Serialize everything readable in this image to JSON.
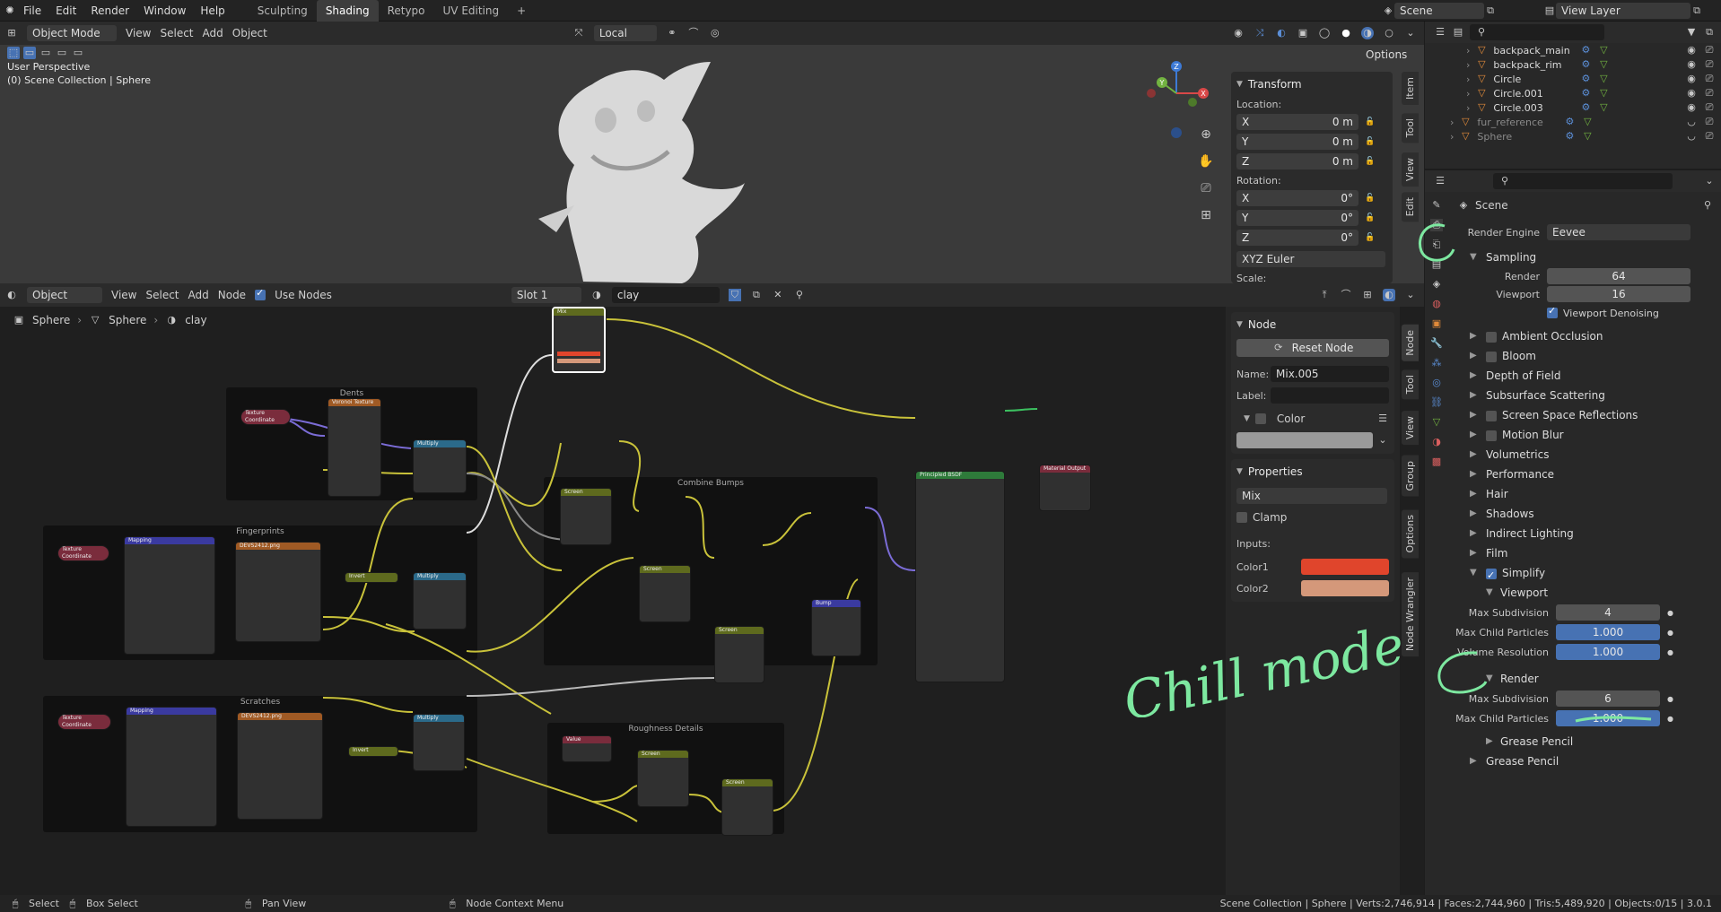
{
  "topbar": {
    "menus": [
      "File",
      "Edit",
      "Render",
      "Window",
      "Help"
    ],
    "workspaces": [
      "Sculpting",
      "Shading",
      "Retypo",
      "UV Editing"
    ],
    "active_workspace": "Shading",
    "add_tab": "+",
    "scene_name": "Scene",
    "view_layer": "View Layer"
  },
  "viewport": {
    "mode": "Object Mode",
    "menus": [
      "View",
      "Select",
      "Add",
      "Object"
    ],
    "orientation": "Local",
    "options": "Options",
    "overlay_title": "User Perspective",
    "overlay_sub": "(0) Scene Collection | Sphere",
    "gizmo": {
      "x": "X",
      "y": "Y",
      "z": "Z"
    },
    "tabs": [
      "Item",
      "Tool",
      "View",
      "Edit"
    ]
  },
  "transform": {
    "title": "Transform",
    "location_label": "Location:",
    "location": [
      {
        "axis": "X",
        "val": "0 m"
      },
      {
        "axis": "Y",
        "val": "0 m"
      },
      {
        "axis": "Z",
        "val": "0 m"
      }
    ],
    "rotation_label": "Rotation:",
    "rotation": [
      {
        "axis": "X",
        "val": "0°"
      },
      {
        "axis": "Y",
        "val": "0°"
      },
      {
        "axis": "Z",
        "val": "0°"
      }
    ],
    "euler": "XYZ Euler",
    "scale_label": "Scale:"
  },
  "node_editor": {
    "mode": "Object",
    "menus": [
      "View",
      "Select",
      "Add",
      "Node"
    ],
    "use_nodes": "Use Nodes",
    "slot": "Slot 1",
    "material": "clay",
    "breadcrumb": [
      "Sphere",
      "Sphere",
      "clay"
    ],
    "tabs": [
      "Node",
      "Tool",
      "View",
      "Group",
      "Options",
      "Node Wrangler"
    ],
    "frames": {
      "dents": "Dents",
      "fingerprints": "Fingerprints",
      "scratches": "Scratches",
      "combine": "Combine Bumps",
      "roughness": "Roughness Details"
    },
    "nodes": {
      "mix": "Mix",
      "texcoord": "Texture Coordinate",
      "voronoi": "Voronoi Texture",
      "multiply": "Multiply",
      "mapping": "Mapping",
      "image": "DEVS2412.png",
      "invert": "Invert",
      "screen": "Screen",
      "bump": "Bump",
      "principled": "Principled BSDF",
      "output": "Material Output",
      "value": "Value"
    }
  },
  "node_panel": {
    "title": "Node",
    "reset": "Reset Node",
    "name_label": "Name:",
    "name": "Mix.005",
    "label_label": "Label:",
    "label": "",
    "color_title": "Color",
    "properties_title": "Properties",
    "blend": "Mix",
    "clamp": "Clamp",
    "inputs_label": "Inputs:",
    "color1": "Color1",
    "color2": "Color2",
    "color1_hex": "#e0452c",
    "color2_hex": "#d4987a"
  },
  "outliner": {
    "items": [
      {
        "name": "backpack_main"
      },
      {
        "name": "backpack_rim"
      },
      {
        "name": "Circle"
      },
      {
        "name": "Circle.001"
      },
      {
        "name": "Circle.003"
      },
      {
        "name": "fur_reference"
      },
      {
        "name": "Sphere"
      }
    ]
  },
  "properties": {
    "scene": "Scene",
    "render_engine_label": "Render Engine",
    "render_engine": "Eevee",
    "sampling": "Sampling",
    "render_label": "Render",
    "render_samples": "64",
    "viewport_label": "Viewport",
    "viewport_samples": "16",
    "viewport_denoising": "Viewport Denoising",
    "sections": [
      "Ambient Occlusion",
      "Bloom",
      "Depth of Field",
      "Subsurface Scattering",
      "Screen Space Reflections",
      "Motion Blur",
      "Volumetrics",
      "Performance",
      "Hair",
      "Shadows",
      "Indirect Lighting",
      "Film"
    ],
    "checkbox_sections": [
      "Ambient Occlusion",
      "Bloom",
      "Screen Space Reflections",
      "Motion Blur"
    ],
    "simplify": "Simplify",
    "viewport_sub": "Viewport",
    "max_subdivision_label": "Max Subdivision",
    "max_subdivision_vp": "4",
    "max_child_particles_label": "Max Child Particles",
    "max_child_particles_vp": "1.000",
    "volume_resolution_label": "Volume Resolution",
    "volume_resolution": "1.000",
    "render_sub": "Render",
    "max_subdivision_r": "6",
    "max_child_particles_r": "1.000",
    "grease_pencil_sub": "Grease Pencil",
    "grease_pencil": "Grease Pencil"
  },
  "annotation": {
    "text": "Chill mode",
    "color": "#7de8a0"
  },
  "statusbar": {
    "select": "Select",
    "box_select": "Box Select",
    "pan_view": "Pan View",
    "node_context": "Node Context Menu",
    "stats": "Scene Collection | Sphere | Verts:2,746,914 | Faces:2,744,960 | Tris:5,489,920 | Objects:0/15 | 3.0.1"
  }
}
